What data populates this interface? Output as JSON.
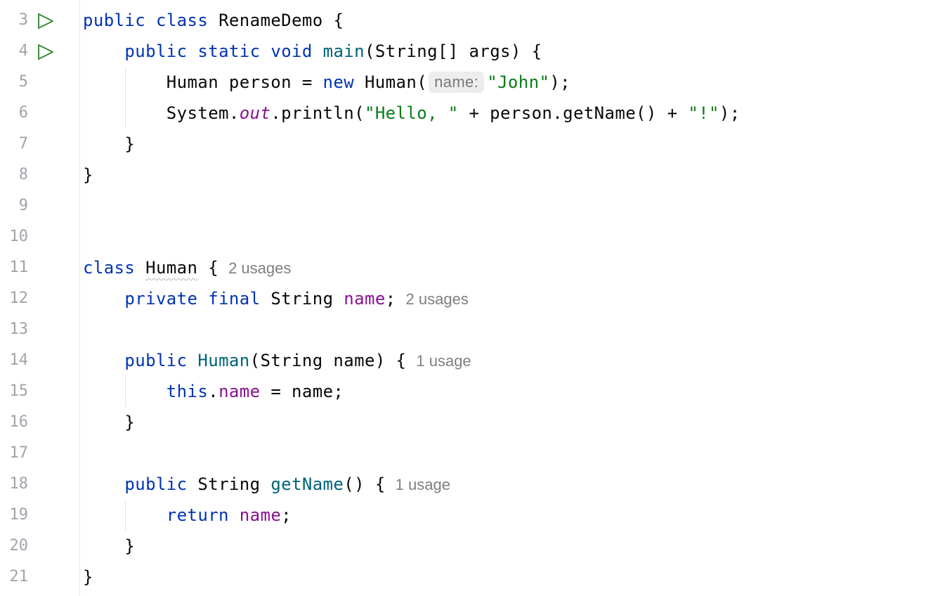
{
  "editor": {
    "language": "Java",
    "line_numbers": [
      "3",
      "4",
      "5",
      "6",
      "7",
      "8",
      "9",
      "10",
      "11",
      "12",
      "13",
      "14",
      "15",
      "16",
      "17",
      "18",
      "19",
      "20",
      "21"
    ],
    "gutter_icons": [
      {
        "line": "3",
        "icon": "run-icon"
      },
      {
        "line": "4",
        "icon": "run-icon"
      }
    ],
    "tokens": {
      "l3": {
        "kw1": "public",
        "kw2": "class",
        "name": "RenameDemo",
        "brace": "{"
      },
      "l4": {
        "kw1": "public",
        "kw2": "static",
        "kw3": "void",
        "method": "main",
        "params": "(String[] args) {"
      },
      "l5": {
        "text1": "Human person = ",
        "kw": "new",
        "text2": " Human(",
        "hint": "name:",
        "str": "\"John\"",
        "text3": ");"
      },
      "l6": {
        "text1": "System.",
        "field": "out",
        "text2": ".println(",
        "str1": "\"Hello, \"",
        "text3": " + person.getName() + ",
        "str2": "\"!\"",
        "text4": ");"
      },
      "l7": {
        "text": "}"
      },
      "l8": {
        "text": "}"
      },
      "l11": {
        "kw": "class",
        "name": "Human",
        "brace": " {",
        "usages": "2 usages"
      },
      "l12": {
        "kw1": "private",
        "kw2": "final",
        "type": " String ",
        "field": "name",
        "semi": ";",
        "usages": "2 usages"
      },
      "l14": {
        "kw": "public",
        "ctor": "Human",
        "params": "(String name) {",
        "usages": "1 usage"
      },
      "l15": {
        "kw": "this",
        "dot": ".",
        "field": "name",
        "rest": " = name;"
      },
      "l16": {
        "text": "}"
      },
      "l18": {
        "kw": "public",
        "type": " String ",
        "method": "getName",
        "rest": "() {",
        "usages": "1 usage"
      },
      "l19": {
        "kw": "return",
        "field": "name",
        "semi": ";"
      },
      "l20": {
        "text": "}"
      },
      "l21": {
        "text": "}"
      }
    }
  },
  "colors": {
    "keyword": "#0033b3",
    "string": "#067d17",
    "field": "#871094",
    "method": "#00627a",
    "run_icon": "#3b8a3e",
    "line_number": "#a0a3ab"
  }
}
